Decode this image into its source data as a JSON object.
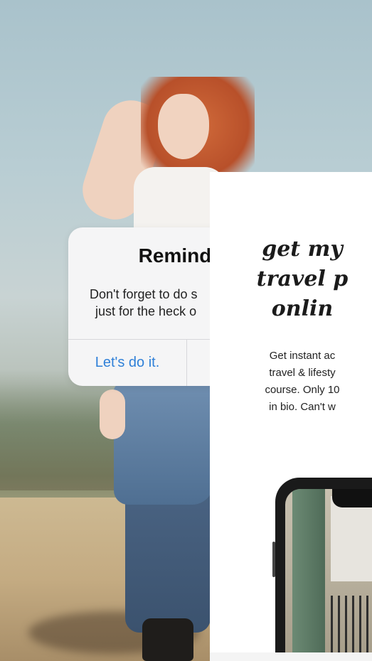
{
  "alert": {
    "title": "Remind",
    "message_line1": "Don't forget to do s",
    "message_line2": "just for the heck o",
    "button_label": "Let's do it.",
    "button_color": "#2f80d8"
  },
  "promo_card": {
    "headline_line1": "get my",
    "headline_line2": "travel p",
    "headline_line3": "onlin",
    "body_line1": "Get instant ac",
    "body_line2": "travel & lifesty",
    "body_line3": "course. Only 10",
    "body_line4": "in bio. Can't w"
  },
  "icons": {
    "phone": "phone-mockup-icon"
  }
}
